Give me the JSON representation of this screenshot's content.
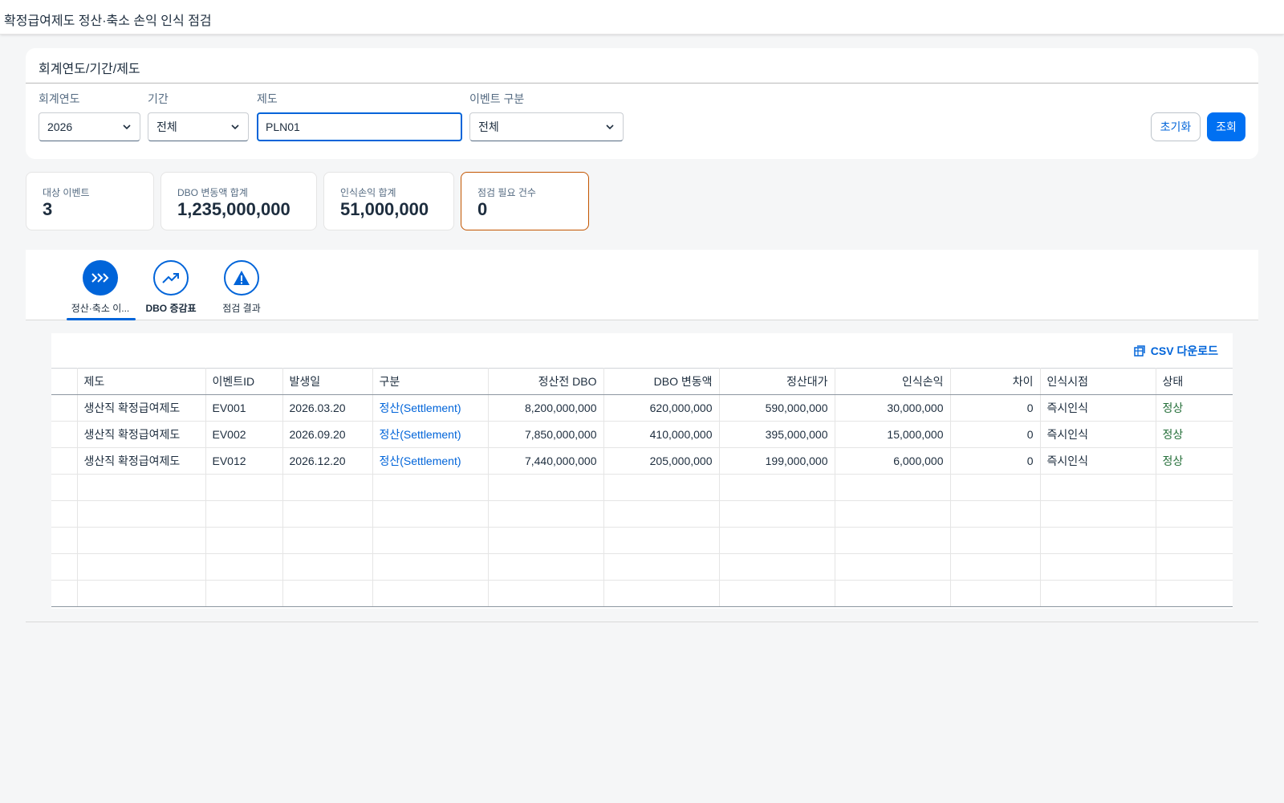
{
  "app": {
    "title": "확정급여제도 정산·축소 손익 인식 점검"
  },
  "filter": {
    "header": "회계연도/기간/제도",
    "fiscal_year": {
      "label": "회계연도",
      "value": "2026"
    },
    "period": {
      "label": "기간",
      "value": "전체"
    },
    "plan": {
      "label": "제도",
      "value": "PLN01"
    },
    "event_type": {
      "label": "이벤트 구분",
      "value": "전체"
    },
    "reset_label": "초기화",
    "search_label": "조회"
  },
  "kpis": [
    {
      "label": "대상 이벤트",
      "value": "3"
    },
    {
      "label": "DBO 변동액 합계",
      "value": "1,235,000,000"
    },
    {
      "label": "인식손익 합계",
      "value": "51,000,000"
    },
    {
      "label": "점검 필요 건수",
      "value": "0"
    }
  ],
  "tabs": [
    {
      "label": "정산·축소 이...",
      "icon": "chevrons-right-icon",
      "active": true
    },
    {
      "label": "DBO 증감표",
      "icon": "trend-up-icon",
      "active": false
    },
    {
      "label": "점검 결과",
      "icon": "warning-icon",
      "active": false
    }
  ],
  "table": {
    "csv_label": "CSV 다운로드",
    "columns": [
      "제도",
      "이벤트ID",
      "발생일",
      "구분",
      "정산전 DBO",
      "DBO 변동액",
      "정산대가",
      "인식손익",
      "차이",
      "인식시점",
      "상태"
    ],
    "rows": [
      [
        "생산직 확정급여제도",
        "EV001",
        "2026.03.20",
        "정산(Settlement)",
        "8,200,000,000",
        "620,000,000",
        "590,000,000",
        "30,000,000",
        "0",
        "즉시인식",
        "정상"
      ],
      [
        "생산직 확정급여제도",
        "EV002",
        "2026.09.20",
        "정산(Settlement)",
        "7,850,000,000",
        "410,000,000",
        "395,000,000",
        "15,000,000",
        "0",
        "즉시인식",
        "정상"
      ],
      [
        "생산직 확정급여제도",
        "EV012",
        "2026.12.20",
        "정산(Settlement)",
        "7,440,000,000",
        "205,000,000",
        "199,000,000",
        "6,000,000",
        "0",
        "즉시인식",
        "정상"
      ]
    ]
  },
  "colors": {
    "accent": "#0064d9",
    "primary_button": "#0070f2",
    "warning_border": "#c35500",
    "status_ok": "#256f3a"
  }
}
